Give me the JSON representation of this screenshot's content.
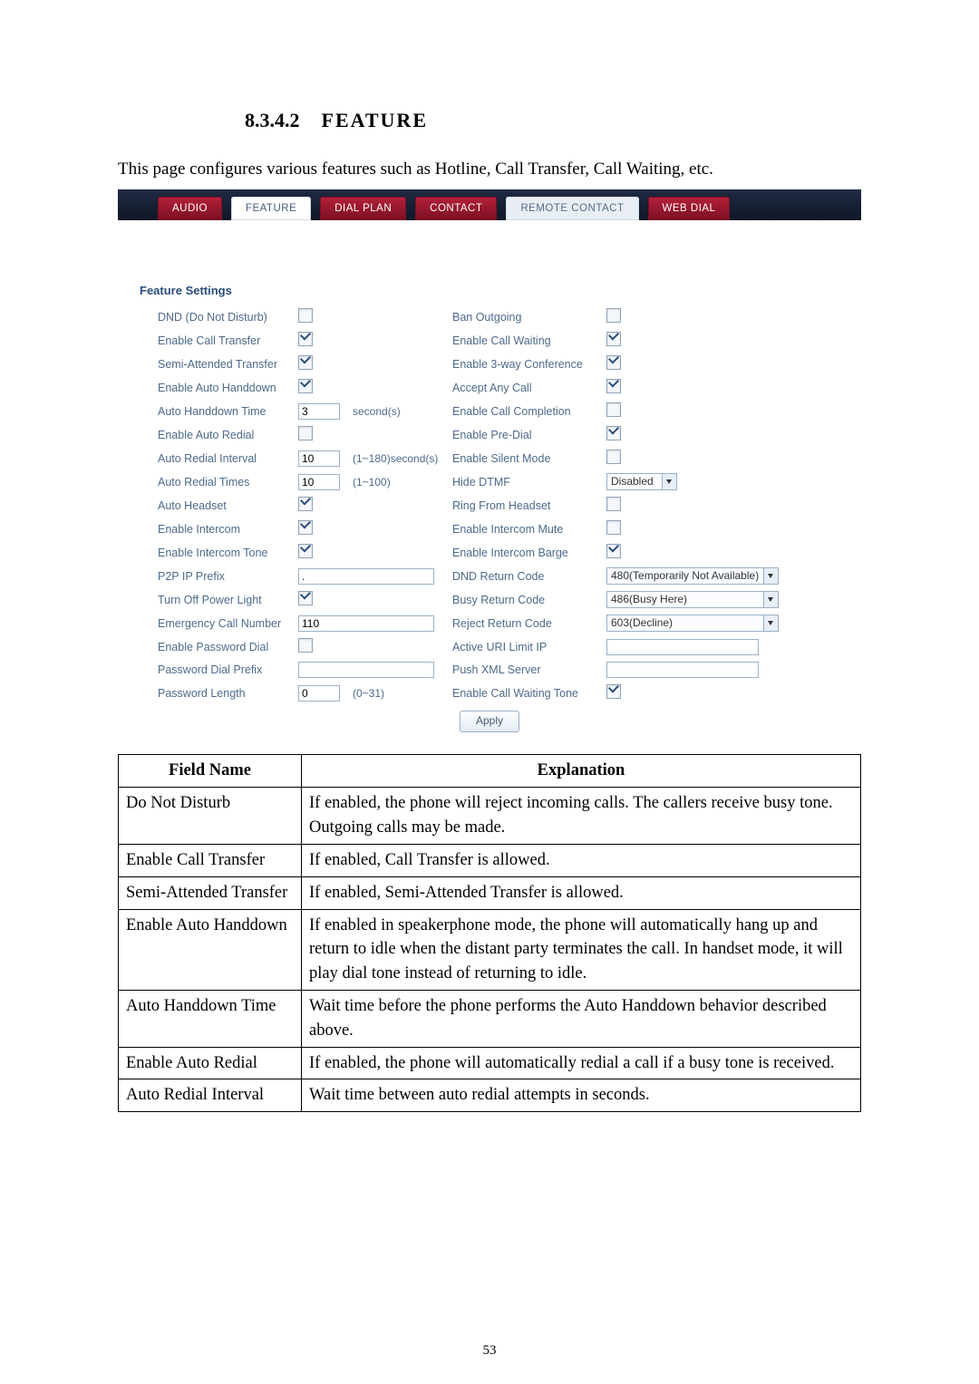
{
  "page_number": "53",
  "heading": {
    "number": "8.3.4.2",
    "title": "FEATURE"
  },
  "intro": "This page configures various features such as Hotline, Call Transfer, Call Waiting, etc.",
  "tabs": {
    "audio": "AUDIO",
    "feature": "FEATURE",
    "dialplan": "DIAL PLAN",
    "contact": "CONTACT",
    "remote": "REMOTE CONTACT",
    "webdial": "WEB DIAL"
  },
  "section_title": "Feature Settings",
  "settings": {
    "dnd": {
      "label": "DND (Do Not Disturb)",
      "checked": false
    },
    "ban_outgoing": {
      "label": "Ban Outgoing",
      "checked": false
    },
    "call_transfer": {
      "label": "Enable Call Transfer",
      "checked": true
    },
    "call_waiting": {
      "label": "Enable Call Waiting",
      "checked": true
    },
    "semi_attended": {
      "label": "Semi-Attended Transfer",
      "checked": true
    },
    "three_way": {
      "label": "Enable 3-way Conference",
      "checked": true
    },
    "auto_handdown": {
      "label": "Enable Auto Handdown",
      "checked": true
    },
    "accept_any": {
      "label": "Accept Any Call",
      "checked": true
    },
    "handdown_time": {
      "label": "Auto Handdown Time",
      "value": "3",
      "suffix": "second(s)"
    },
    "call_completion": {
      "label": "Enable Call Completion",
      "checked": false
    },
    "auto_redial": {
      "label": "Enable Auto Redial",
      "checked": false
    },
    "pre_dial": {
      "label": "Enable Pre-Dial",
      "checked": true
    },
    "redial_interval": {
      "label": "Auto Redial Interval",
      "value": "10",
      "suffix": "(1~180)second(s)"
    },
    "silent_mode": {
      "label": "Enable Silent Mode",
      "checked": false
    },
    "redial_times": {
      "label": "Auto Redial Times",
      "value": "10",
      "suffix": "(1~100)"
    },
    "hide_dtmf": {
      "label": "Hide DTMF",
      "value": "Disabled"
    },
    "auto_headset": {
      "label": "Auto Headset",
      "checked": true
    },
    "ring_headset": {
      "label": "Ring From Headset",
      "checked": false
    },
    "intercom": {
      "label": "Enable Intercom",
      "checked": true
    },
    "intercom_mute": {
      "label": "Enable Intercom Mute",
      "checked": false
    },
    "intercom_tone": {
      "label": "Enable Intercom Tone",
      "checked": true
    },
    "intercom_barge": {
      "label": "Enable Intercom Barge",
      "checked": true
    },
    "p2p_prefix": {
      "label": "P2P IP Prefix",
      "value": "."
    },
    "dnd_return": {
      "label": "DND Return Code",
      "value": "480(Temporarily Not Available)"
    },
    "power_light": {
      "label": "Turn Off Power Light",
      "checked": true
    },
    "busy_return": {
      "label": "Busy Return Code",
      "value": "486(Busy Here)"
    },
    "emergency": {
      "label": "Emergency Call Number",
      "value": "110"
    },
    "reject_return": {
      "label": "Reject Return Code",
      "value": "603(Decline)"
    },
    "password_dial": {
      "label": "Enable Password Dial",
      "checked": false
    },
    "active_uri": {
      "label": "Active URI Limit IP",
      "value": ""
    },
    "password_prefix": {
      "label": "Password Dial Prefix",
      "value": ""
    },
    "push_xml": {
      "label": "Push XML Server",
      "value": ""
    },
    "password_length": {
      "label": "Password Length",
      "value": "0",
      "suffix": "(0~31)"
    },
    "cw_tone": {
      "label": "Enable Call Waiting Tone",
      "checked": true
    }
  },
  "apply": "Apply",
  "table": {
    "headers": {
      "field": "Field Name",
      "explanation": "Explanation"
    },
    "rows": [
      {
        "field": "Do Not Disturb",
        "expl": "If enabled, the phone will reject incoming calls.   The callers receive busy tone.   Outgoing calls may be made."
      },
      {
        "field": "Enable Call Transfer",
        "expl": "If enabled, Call Transfer is allowed."
      },
      {
        "field": "Semi-Attended Transfer",
        "expl": "If enabled, Semi-Attended Transfer is allowed."
      },
      {
        "field": "Enable Auto Handdown",
        "expl": "If enabled in speakerphone mode, the phone will automatically hang up and return to idle when the distant party terminates the call.   In handset mode, it will play dial tone instead of returning to idle."
      },
      {
        "field": "Auto Handdown Time",
        "expl": "Wait time before the phone performs the Auto Handdown behavior described above."
      },
      {
        "field": "Enable Auto Redial",
        "expl": "If enabled, the phone will automatically redial a call if a busy tone is received."
      },
      {
        "field": "Auto Redial Interval",
        "expl": "Wait time between auto redial attempts in seconds."
      }
    ]
  }
}
